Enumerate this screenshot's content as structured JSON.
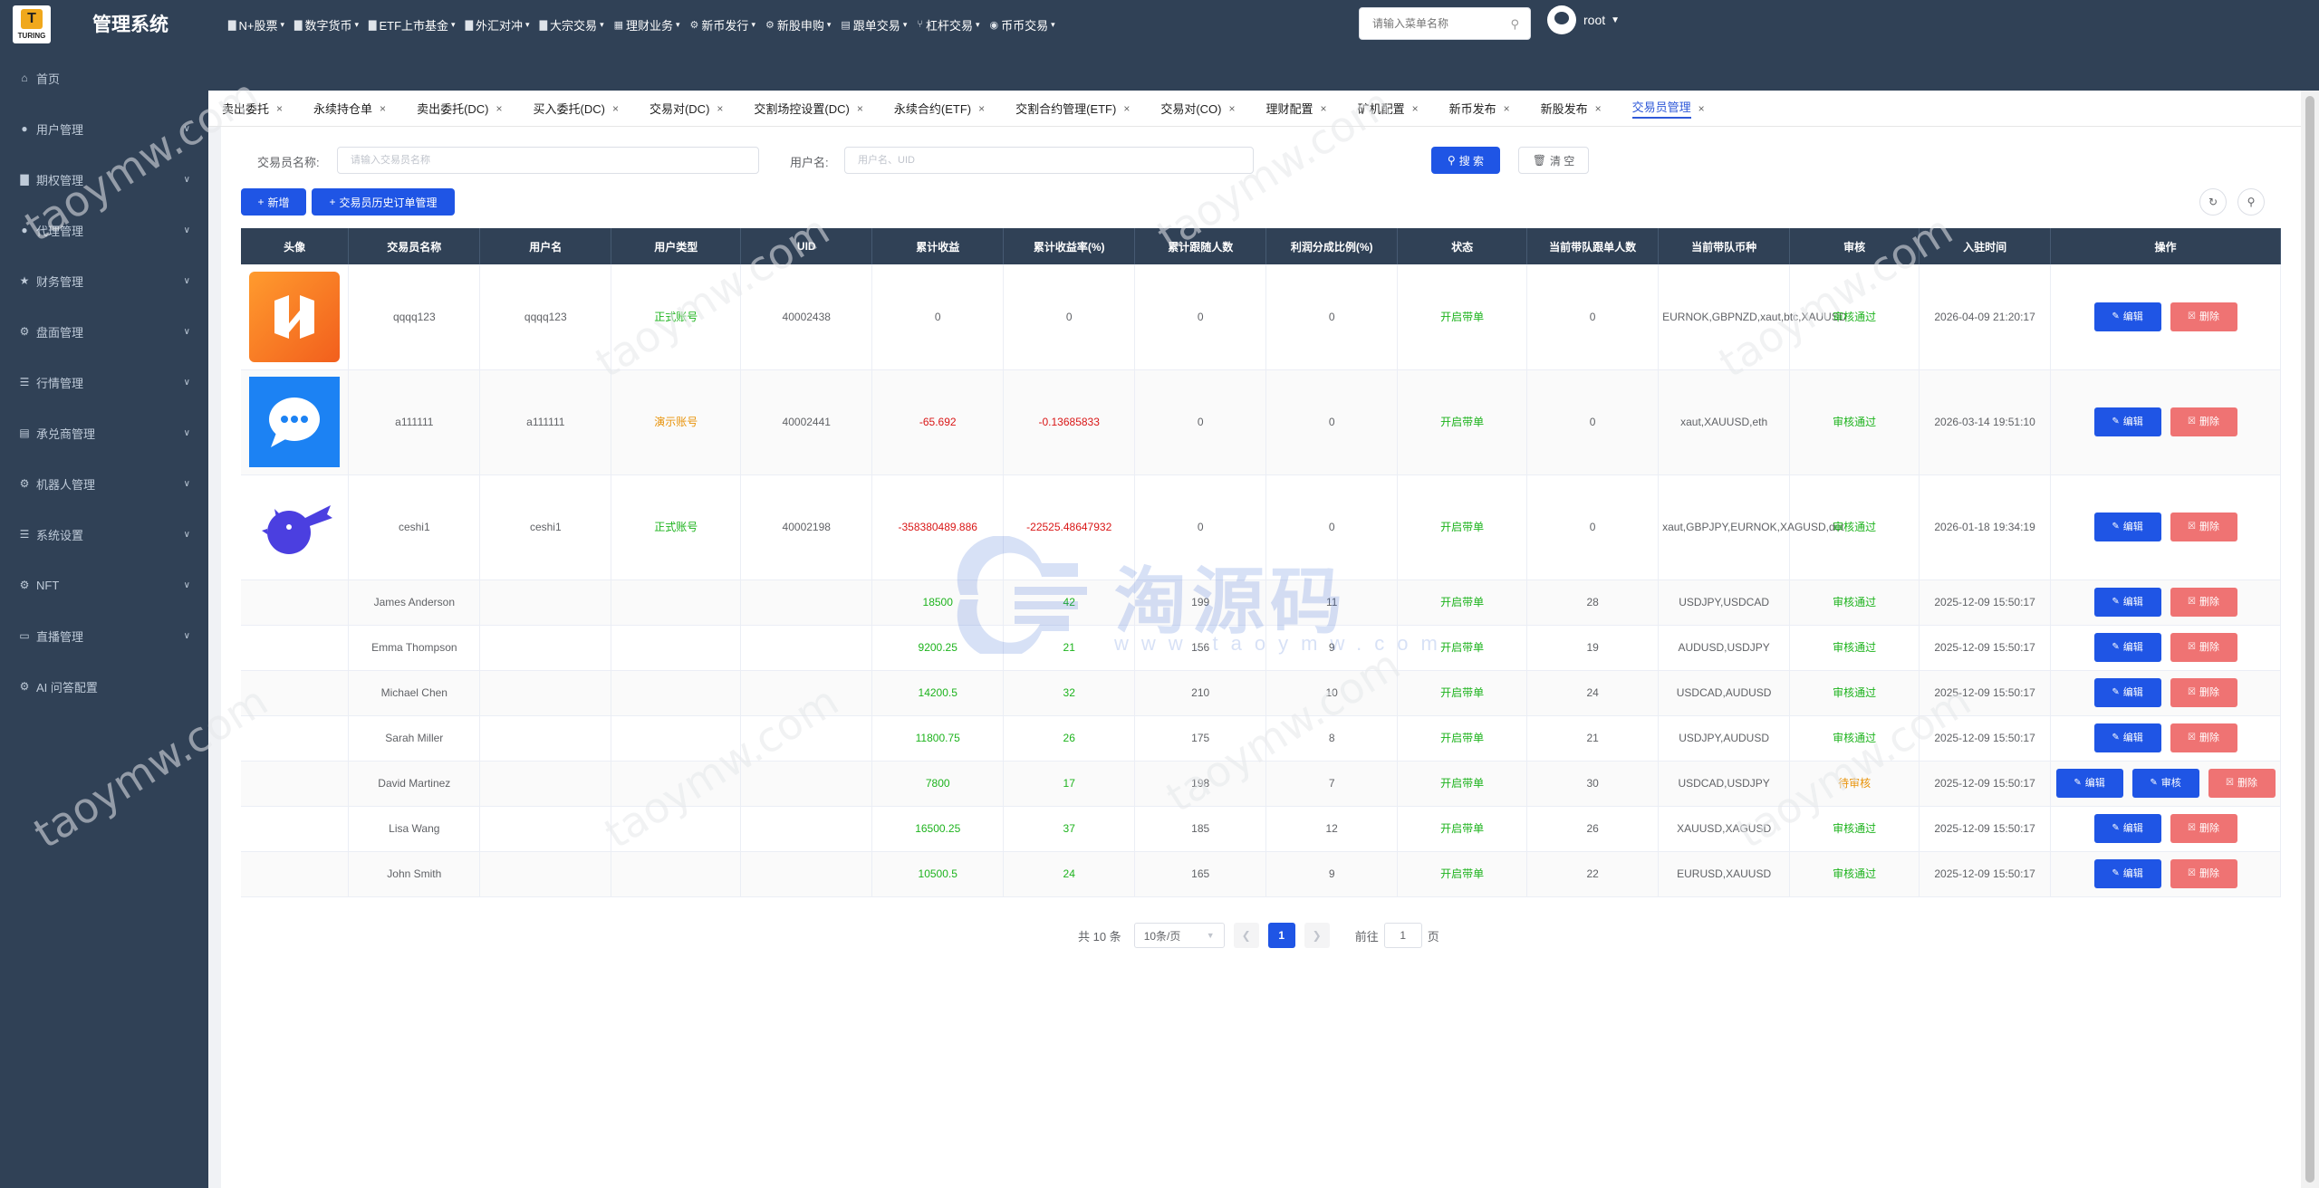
{
  "app": {
    "logo_text": "TURING",
    "title": "管理系统"
  },
  "topnav": [
    {
      "label": "N+股票",
      "icon": "chart-icon"
    },
    {
      "label": "数字货币",
      "icon": "chart-icon"
    },
    {
      "label": "ETF上市基金",
      "icon": "chart-icon"
    },
    {
      "label": "外汇对冲",
      "icon": "chart-icon"
    },
    {
      "label": "大宗交易",
      "icon": "chart-icon"
    },
    {
      "label": "理财业务",
      "icon": "grid-icon"
    },
    {
      "label": "新币发行",
      "icon": "gear-icon"
    },
    {
      "label": "新股申购",
      "icon": "gear-icon"
    },
    {
      "label": "跟单交易",
      "icon": "doc-icon"
    },
    {
      "label": "杠杆交易",
      "icon": "share-icon"
    },
    {
      "label": "币币交易",
      "icon": "pin-icon"
    }
  ],
  "search": {
    "placeholder": "请输入菜单名称"
  },
  "user": {
    "name": "root"
  },
  "sidebar": [
    {
      "label": "首页",
      "icon": "home-icon",
      "has_arrow": false
    },
    {
      "label": "用户管理",
      "icon": "user-icon",
      "has_arrow": true
    },
    {
      "label": "期权管理",
      "icon": "chart-icon",
      "has_arrow": true
    },
    {
      "label": "代理管理",
      "icon": "user-icon",
      "has_arrow": true
    },
    {
      "label": "财务管理",
      "icon": "star-icon",
      "has_arrow": true
    },
    {
      "label": "盘面管理",
      "icon": "gear-icon",
      "has_arrow": true
    },
    {
      "label": "行情管理",
      "icon": "list-icon",
      "has_arrow": true
    },
    {
      "label": "承兑商管理",
      "icon": "doc-icon",
      "has_arrow": true
    },
    {
      "label": "机器人管理",
      "icon": "gear-icon",
      "has_arrow": true
    },
    {
      "label": "系统设置",
      "icon": "list-icon",
      "has_arrow": true
    },
    {
      "label": "NFT",
      "icon": "gear-icon",
      "has_arrow": true
    },
    {
      "label": "直播管理",
      "icon": "video-icon",
      "has_arrow": true
    },
    {
      "label": "AI 问答配置",
      "icon": "gear-icon",
      "has_arrow": false
    }
  ],
  "tabs": [
    {
      "label": "卖出委托",
      "active": false
    },
    {
      "label": "永续持仓单",
      "active": false
    },
    {
      "label": "卖出委托(DC)",
      "active": false
    },
    {
      "label": "买入委托(DC)",
      "active": false
    },
    {
      "label": "交易对(DC)",
      "active": false
    },
    {
      "label": "交割场控设置(DC)",
      "active": false
    },
    {
      "label": "永续合约(ETF)",
      "active": false
    },
    {
      "label": "交割合约管理(ETF)",
      "active": false
    },
    {
      "label": "交易对(CO)",
      "active": false
    },
    {
      "label": "理财配置",
      "active": false
    },
    {
      "label": "矿机配置",
      "active": false
    },
    {
      "label": "新币发布",
      "active": false
    },
    {
      "label": "新股发布",
      "active": false
    },
    {
      "label": "交易员管理",
      "active": true
    }
  ],
  "filters": {
    "trader_name_label": "交易员名称:",
    "trader_name_placeholder": "请输入交易员名称",
    "username_label": "用户名:",
    "username_placeholder": "用户名、UID",
    "search_label": "搜 索",
    "reset_label": "清 空"
  },
  "actions": {
    "add_label": "新增",
    "history_label": "交易员历史订单管理"
  },
  "table": {
    "headers": [
      "头像",
      "交易员名称",
      "用户名",
      "用户类型",
      "UID",
      "累计收益",
      "累计收益率(%)",
      "累计跟随人数",
      "利润分成比例(%)",
      "状态",
      "当前带队跟单人数",
      "当前带队币种",
      "审核",
      "入驻时间",
      "操作"
    ],
    "rows": [
      {
        "avatar": "orange-logo",
        "name": "qqqq123",
        "username": "qqqq123",
        "user_type": "正式账号",
        "type_color": "green",
        "uid": "40002438",
        "profit": "0",
        "profit_color": "",
        "profit_rate": "0",
        "rate_color": "",
        "followers": "0",
        "share_ratio": "0",
        "status": "开启带单",
        "current_followers": "0",
        "currencies": "EURNOK,GBPNZD,xaut,btc,XAUUSD",
        "review": "审核通过",
        "review_color": "green",
        "join_time": "2026-04-09 21:20:17",
        "show_review_btn": false
      },
      {
        "avatar": "chat-logo",
        "name": "a111111",
        "username": "a111111",
        "user_type": "演示账号",
        "type_color": "orange",
        "uid": "40002441",
        "profit": "-65.692",
        "profit_color": "red",
        "profit_rate": "-0.13685833",
        "rate_color": "red",
        "followers": "0",
        "share_ratio": "0",
        "status": "开启带单",
        "current_followers": "0",
        "currencies": "xaut,XAUUSD,eth",
        "review": "审核通过",
        "review_color": "green",
        "join_time": "2026-03-14 19:51:10",
        "show_review_btn": false
      },
      {
        "avatar": "bird-logo",
        "name": "ceshi1",
        "username": "ceshi1",
        "user_type": "正式账号",
        "type_color": "green",
        "uid": "40002198",
        "profit": "-358380489.886",
        "profit_color": "red",
        "profit_rate": "-22525.48647932",
        "rate_color": "red",
        "followers": "0",
        "share_ratio": "0",
        "status": "开启带单",
        "current_followers": "0",
        "currencies": "xaut,GBPJPY,EURNOK,XAGUSD,dot",
        "review": "审核通过",
        "review_color": "green",
        "join_time": "2026-01-18 19:34:19",
        "show_review_btn": false
      },
      {
        "avatar": "",
        "name": "James Anderson",
        "username": "",
        "user_type": "",
        "type_color": "",
        "uid": "",
        "profit": "18500",
        "profit_color": "green",
        "profit_rate": "42",
        "rate_color": "green",
        "followers": "199",
        "share_ratio": "11",
        "status": "开启带单",
        "current_followers": "28",
        "currencies": "USDJPY,USDCAD",
        "review": "审核通过",
        "review_color": "green",
        "join_time": "2025-12-09 15:50:17",
        "show_review_btn": false
      },
      {
        "avatar": "",
        "name": "Emma Thompson",
        "username": "",
        "user_type": "",
        "type_color": "",
        "uid": "",
        "profit": "9200.25",
        "profit_color": "green",
        "profit_rate": "21",
        "rate_color": "green",
        "followers": "156",
        "share_ratio": "9",
        "status": "开启带单",
        "current_followers": "19",
        "currencies": "AUDUSD,USDJPY",
        "review": "审核通过",
        "review_color": "green",
        "join_time": "2025-12-09 15:50:17",
        "show_review_btn": false
      },
      {
        "avatar": "",
        "name": "Michael Chen",
        "username": "",
        "user_type": "",
        "type_color": "",
        "uid": "",
        "profit": "14200.5",
        "profit_color": "green",
        "profit_rate": "32",
        "rate_color": "green",
        "followers": "210",
        "share_ratio": "10",
        "status": "开启带单",
        "current_followers": "24",
        "currencies": "USDCAD,AUDUSD",
        "review": "审核通过",
        "review_color": "green",
        "join_time": "2025-12-09 15:50:17",
        "show_review_btn": false
      },
      {
        "avatar": "",
        "name": "Sarah Miller",
        "username": "",
        "user_type": "",
        "type_color": "",
        "uid": "",
        "profit": "11800.75",
        "profit_color": "green",
        "profit_rate": "26",
        "rate_color": "green",
        "followers": "175",
        "share_ratio": "8",
        "status": "开启带单",
        "current_followers": "21",
        "currencies": "USDJPY,AUDUSD",
        "review": "审核通过",
        "review_color": "green",
        "join_time": "2025-12-09 15:50:17",
        "show_review_btn": false
      },
      {
        "avatar": "",
        "name": "David Martinez",
        "username": "",
        "user_type": "",
        "type_color": "",
        "uid": "",
        "profit": "7800",
        "profit_color": "green",
        "profit_rate": "17",
        "rate_color": "green",
        "followers": "198",
        "share_ratio": "7",
        "status": "开启带单",
        "current_followers": "30",
        "currencies": "USDCAD,USDJPY",
        "review": "待审核",
        "review_color": "orange",
        "join_time": "2025-12-09 15:50:17",
        "show_review_btn": true
      },
      {
        "avatar": "",
        "name": "Lisa Wang",
        "username": "",
        "user_type": "",
        "type_color": "",
        "uid": "",
        "profit": "16500.25",
        "profit_color": "green",
        "profit_rate": "37",
        "rate_color": "green",
        "followers": "185",
        "share_ratio": "12",
        "status": "开启带单",
        "current_followers": "26",
        "currencies": "XAUUSD,XAGUSD",
        "review": "审核通过",
        "review_color": "green",
        "join_time": "2025-12-09 15:50:17",
        "show_review_btn": false
      },
      {
        "avatar": "",
        "name": "John Smith",
        "username": "",
        "user_type": "",
        "type_color": "",
        "uid": "",
        "profit": "10500.5",
        "profit_color": "green",
        "profit_rate": "24",
        "rate_color": "green",
        "followers": "165",
        "share_ratio": "9",
        "status": "开启带单",
        "current_followers": "22",
        "currencies": "EURUSD,XAUUSD",
        "review": "审核通过",
        "review_color": "green",
        "join_time": "2025-12-09 15:50:17",
        "show_review_btn": false
      }
    ],
    "edit_label": "编辑",
    "review_label": "审核",
    "delete_label": "删除"
  },
  "pagination": {
    "total_text": "共 10 条",
    "page_size": "10条/页",
    "current_page": "1",
    "goto_label": "前往",
    "goto_value": "1",
    "page_suffix": "页"
  },
  "watermark": {
    "brand": "淘源码",
    "url": "www.taoymw.com",
    "diagonal": "taoymw.com"
  },
  "colors": {
    "sidebar_bg": "#304156",
    "primary": "#1f55e5",
    "danger": "#ef7373",
    "success": "#1db31d",
    "warning": "#e8930a",
    "negative": "#d91616"
  }
}
